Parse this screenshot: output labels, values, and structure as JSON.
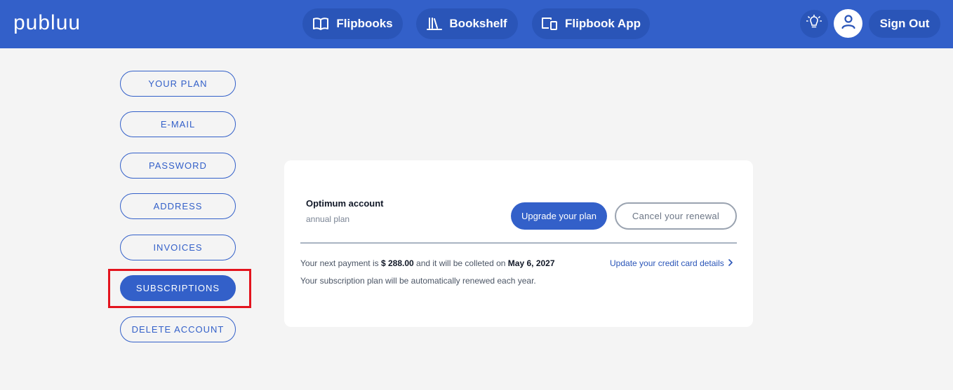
{
  "header": {
    "logo": "publuu",
    "nav": [
      {
        "label": "Flipbooks",
        "icon": "open-book-icon"
      },
      {
        "label": "Bookshelf",
        "icon": "bookshelf-icon"
      },
      {
        "label": "Flipbook App",
        "icon": "devices-icon"
      }
    ],
    "tip_icon": "lightbulb-icon",
    "avatar_icon": "user-icon",
    "sign_out": "Sign Out"
  },
  "sidebar": {
    "items": [
      {
        "label": "YOUR PLAN"
      },
      {
        "label": "E-MAIL"
      },
      {
        "label": "PASSWORD"
      },
      {
        "label": "ADDRESS"
      },
      {
        "label": "INVOICES"
      },
      {
        "label": "SUBSCRIPTIONS",
        "active": true
      },
      {
        "label": "DELETE ACCOUNT"
      }
    ]
  },
  "subscription": {
    "plan_name": "Optimum account",
    "plan_type": "annual plan",
    "upgrade_label": "Upgrade your plan",
    "cancel_label": "Cancel your renewal",
    "payment_prefix": "Your next payment is",
    "payment_amount": "$ 288.00",
    "payment_middle": "and it will be colleted on",
    "payment_date": "May 6, 2027",
    "renewal_note": "Your subscription plan will be automatically renewed each year.",
    "update_card_label": "Update your credit card details"
  },
  "colors": {
    "brand": "#3360c9",
    "nav_button": "#2a55b8",
    "highlight": "#e3141e",
    "background": "#f4f4f4"
  }
}
